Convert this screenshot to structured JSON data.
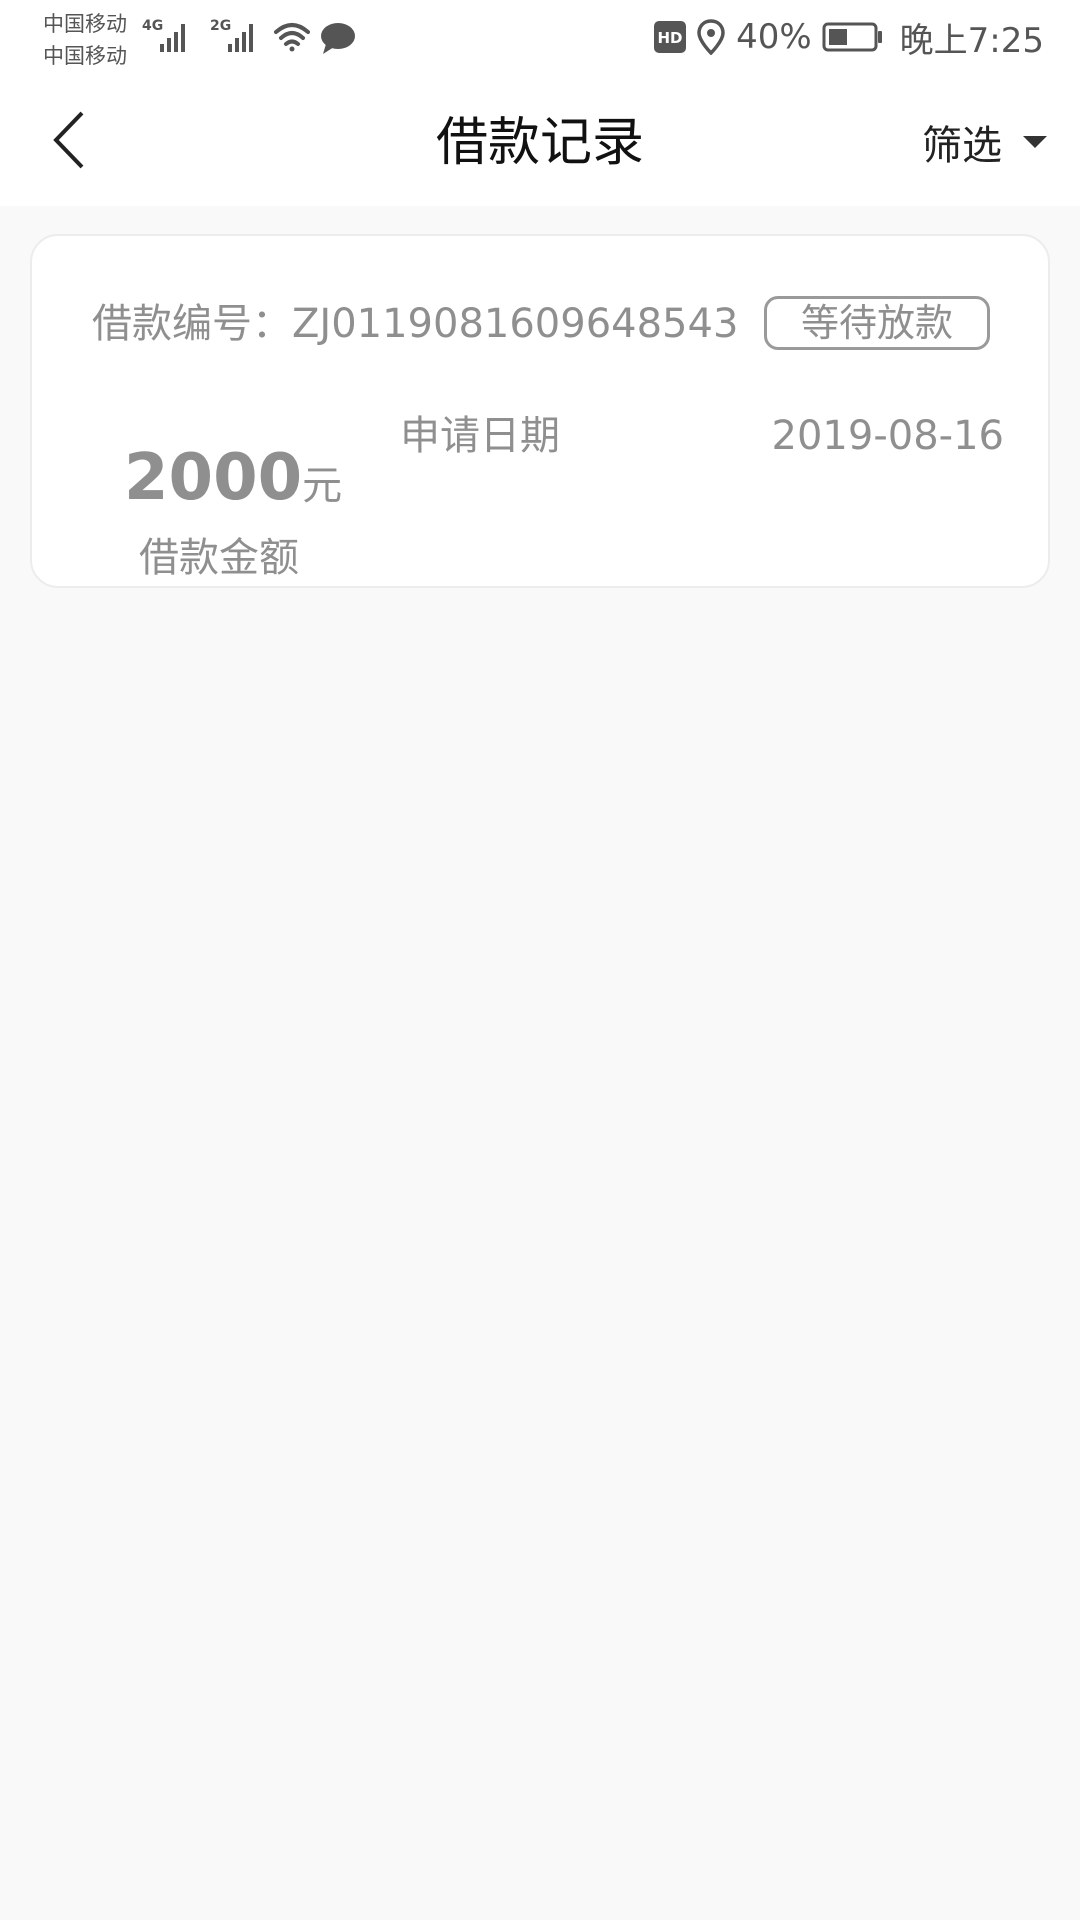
{
  "status_bar": {
    "carrier_1": "中国移动",
    "carrier_2": "中国移动",
    "network_1": "4G",
    "network_2": "2G",
    "hd_badge": "HD",
    "battery": "40%",
    "time": "晚上7:25"
  },
  "nav": {
    "title": "借款记录",
    "filter_label": "筛选"
  },
  "record": {
    "loan_no_label": "借款编号：",
    "loan_no": "ZJ0119081609648543",
    "status": "等待放款",
    "apply_date_label": "申请日期",
    "apply_date": "2019-08-16",
    "amount": "2000",
    "amount_unit": "元",
    "amount_label": "借款金额"
  },
  "colors": {
    "background": "#f9f9f9",
    "card": "#ffffff",
    "muted_text": "#8f8f8f",
    "title_text": "#111111"
  }
}
